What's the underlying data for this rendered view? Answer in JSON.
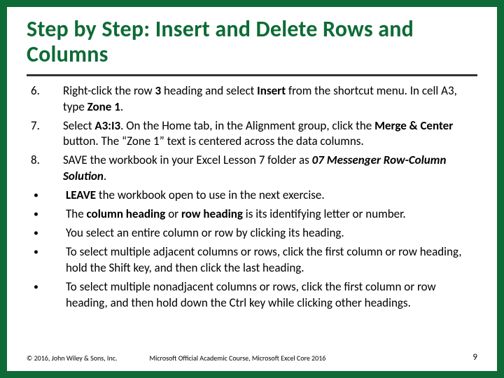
{
  "title": "Step by Step: Insert and Delete Rows and Columns",
  "numbered": [
    {
      "n": "6.",
      "html": "Right-click the row <b>3</b> heading and select <b>Insert</b> from the shortcut menu. In cell A3, type <b>Zone 1</b>."
    },
    {
      "n": "7.",
      "html": "Select <b>A3:I3</b>. On the Home tab, in the Alignment group, click the <b>Merge &amp; Center</b> button. The “Zone 1” text is centered across the data columns."
    },
    {
      "n": "8.",
      "html": "SAVE the workbook in your Excel Lesson 7 folder as <b><i>07 Messenger Row-Column Solution</i></b>."
    }
  ],
  "bullets": [
    {
      "html": "<b>LEAVE</b> the workbook open to use in the next exercise."
    },
    {
      "html": "The <b>column heading</b> or <b>row heading</b> is its identifying letter or number."
    },
    {
      "html": "You select an entire column or row by clicking its heading."
    },
    {
      "html": "To select multiple adjacent columns or rows, click the first column or row heading, hold the Shift key, and then click the last heading."
    },
    {
      "html": "To select multiple nonadjacent columns or rows, click the first column or row heading, and then hold down the Ctrl key while clicking other headings."
    }
  ],
  "footer": {
    "copyright": "© 2016, John Wiley & Sons, Inc.",
    "course": "Microsoft Official Academic Course, Microsoft Excel Core 2016",
    "page": "9"
  }
}
